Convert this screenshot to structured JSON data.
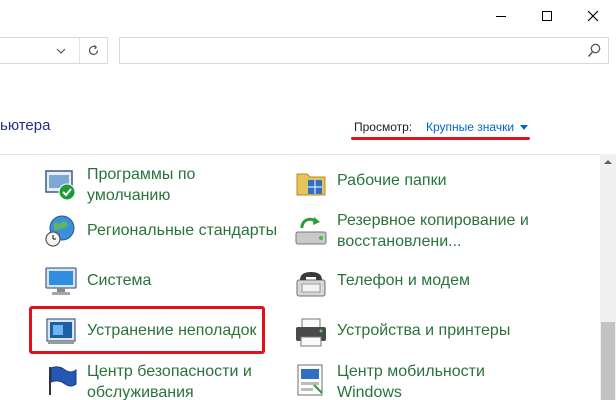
{
  "window": {
    "controls": [
      "minimize",
      "maximize",
      "close"
    ]
  },
  "search": {
    "placeholder": ""
  },
  "header": {
    "breadcrumb": "ьютера",
    "view_label": "Просмотр:",
    "view_value": "Крупные значки"
  },
  "items_left": [
    {
      "label_line1": "Программы по",
      "label_line2": "умолчанию",
      "icon": "default-programs-icon"
    },
    {
      "label": "Региональные стандарты",
      "icon": "globe-clock-icon"
    },
    {
      "label": "Система",
      "icon": "system-monitor-icon"
    },
    {
      "label": "Устранение неполадок",
      "icon": "troubleshooting-icon"
    },
    {
      "label_line1": "Центр безопасности и",
      "label_line2": "обслуживания",
      "icon": "flag-icon"
    }
  ],
  "items_right": [
    {
      "label": "Рабочие папки",
      "icon": "work-folders-icon"
    },
    {
      "label_line1": "Резервное копирование и",
      "label_line2": "восстановлени...",
      "icon": "backup-restore-icon"
    },
    {
      "label": "Телефон и модем",
      "icon": "phone-modem-icon"
    },
    {
      "label": "Устройства и принтеры",
      "icon": "printer-icon"
    },
    {
      "label_line1": "Центр мобильности",
      "label_line2": "Windows",
      "icon": "mobility-center-icon"
    }
  ],
  "colors": {
    "link": "#29733b",
    "accent": "#0066cc",
    "highlight": "#e0101c"
  }
}
